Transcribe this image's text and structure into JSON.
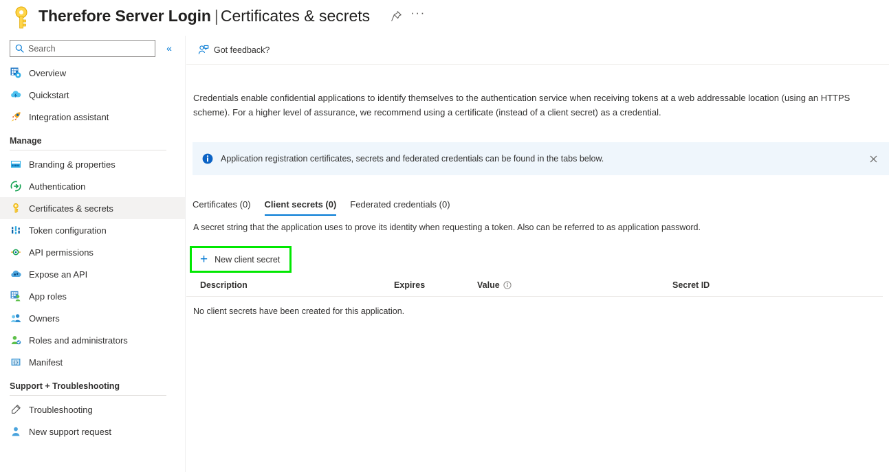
{
  "header": {
    "app_name": "Therefore Server Login",
    "separator": "|",
    "blade_name": "Certificates & secrets",
    "key_icon": "key-icon",
    "pin_label": "Pin blade",
    "more_label": "···"
  },
  "sidebar": {
    "search": {
      "placeholder": "Search",
      "value": ""
    },
    "collapse_label": "«",
    "top_items": [
      {
        "label": "Overview",
        "icon": "overview-icon"
      },
      {
        "label": "Quickstart",
        "icon": "quickstart-icon"
      },
      {
        "label": "Integration assistant",
        "icon": "rocket-icon"
      }
    ],
    "sections": [
      {
        "title": "Manage",
        "items": [
          {
            "label": "Branding & properties",
            "icon": "branding-icon"
          },
          {
            "label": "Authentication",
            "icon": "authentication-icon"
          },
          {
            "label": "Certificates & secrets",
            "icon": "key-icon",
            "selected": true
          },
          {
            "label": "Token configuration",
            "icon": "token-icon"
          },
          {
            "label": "API permissions",
            "icon": "api-permissions-icon"
          },
          {
            "label": "Expose an API",
            "icon": "expose-api-icon"
          },
          {
            "label": "App roles",
            "icon": "app-roles-icon"
          },
          {
            "label": "Owners",
            "icon": "owners-icon"
          },
          {
            "label": "Roles and administrators",
            "icon": "roles-admins-icon"
          },
          {
            "label": "Manifest",
            "icon": "manifest-icon"
          }
        ]
      },
      {
        "title": "Support + Troubleshooting",
        "items": [
          {
            "label": "Troubleshooting",
            "icon": "troubleshooting-icon"
          },
          {
            "label": "New support request",
            "icon": "support-request-icon"
          }
        ]
      }
    ]
  },
  "main": {
    "command_bar": {
      "feedback_label": "Got feedback?",
      "feedback_icon": "feedback-person-icon"
    },
    "intro_text": "Credentials enable confidential applications to identify themselves to the authentication service when receiving tokens at a web addressable location (using an HTTPS scheme). For a higher level of assurance, we recommend using a certificate (instead of a client secret) as a credential.",
    "info_bar": {
      "icon": "info-circle-icon",
      "text": "Application registration certificates, secrets and federated credentials can be found in the tabs below.",
      "close_label": "✕"
    },
    "tabs": [
      {
        "label": "Certificates (0)",
        "active": false
      },
      {
        "label": "Client secrets (0)",
        "active": true
      },
      {
        "label": "Federated credentials (0)",
        "active": false
      }
    ],
    "tab_description": "A secret string that the application uses to prove its identity when requesting a token. Also can be referred to as application password.",
    "new_secret_button": {
      "label": "New client secret",
      "icon": "plus-icon"
    },
    "table": {
      "columns": [
        "Description",
        "Expires",
        "Value",
        "Secret ID"
      ],
      "value_info_icon": "info-outline-icon",
      "rows": [],
      "empty_message": "No client secrets have been created for this application."
    }
  },
  "colors": {
    "accent": "#0078d4",
    "highlight_box": "#00e800",
    "info_bar_bg": "#eff6fc",
    "selected_nav_bg": "#f3f2f1"
  }
}
